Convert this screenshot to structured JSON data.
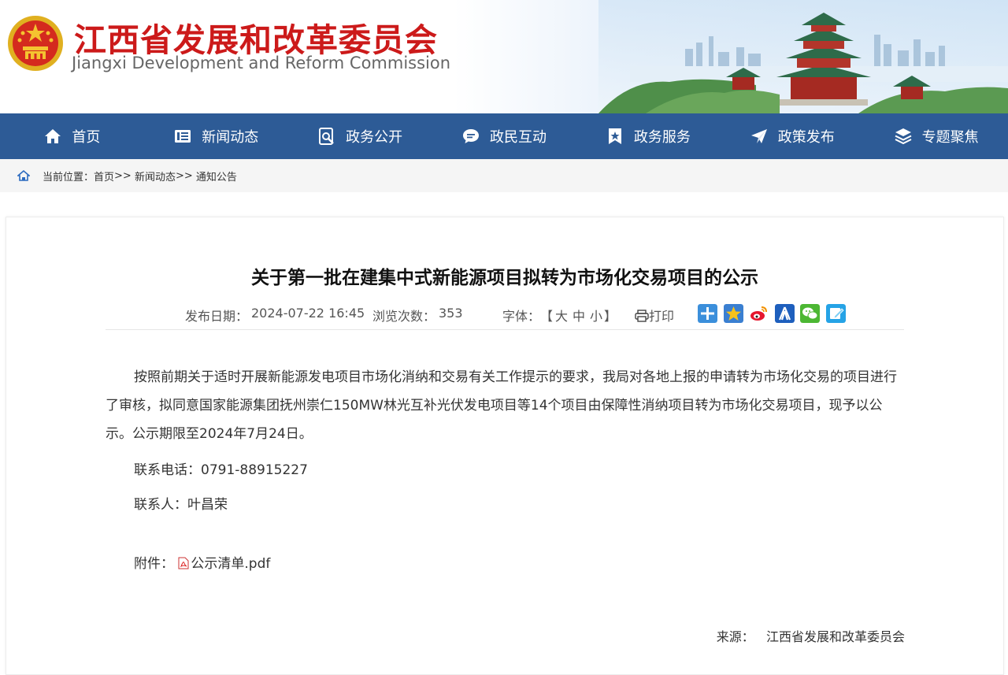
{
  "header": {
    "title": "江西省发展和改革委员会",
    "subtitle": "Jiangxi Development and Reform Commission"
  },
  "nav": {
    "items": [
      {
        "label": "首页",
        "icon": "home-icon"
      },
      {
        "label": "新闻动态",
        "icon": "news-icon"
      },
      {
        "label": "政务公开",
        "icon": "gov-open-icon"
      },
      {
        "label": "政民互动",
        "icon": "chat-icon"
      },
      {
        "label": "政务服务",
        "icon": "service-star-icon"
      },
      {
        "label": "政策发布",
        "icon": "send-icon"
      },
      {
        "label": "专题聚焦",
        "icon": "layers-icon"
      }
    ]
  },
  "breadcrumb": {
    "prefix": "当前位置：",
    "items": [
      "首页",
      ">>",
      "新闻动态",
      ">>",
      "通知公告"
    ]
  },
  "article": {
    "title": "关于第一批在建集中式新能源项目拟转为市场化交易项目的公示",
    "date_label": "发布日期：",
    "date": "2024-07-22 16:45",
    "views_label": "浏览次数：",
    "views": "353",
    "font_label": "字体：",
    "font_open": "【",
    "font_large": "大",
    "font_medium": "中",
    "font_small": "小",
    "font_close": "】",
    "print_label": "打印",
    "share_icons": [
      "plus-share-icon",
      "qzone-icon",
      "weibo-icon",
      "renren-icon",
      "wechat-icon",
      "note-icon"
    ],
    "paragraph": "按照前期关于适时开展新能源发电项目市场化消纳和交易有关工作提示的要求，我局对各地上报的申请转为市场化交易的项目进行了审核，拟同意国家能源集团抚州崇仁150MW林光互补光伏发电项目等14个项目由保障性消纳项目转为市场化交易项目，现予以公示。公示期限至2024年7月24日。",
    "phone": "联系电话：0791-88915227",
    "contact": "联系人：叶昌荣",
    "attachment_label": "附件：",
    "attachment_name": "公示清单.pdf",
    "source_label": "来源：",
    "source": "江西省发展和改革委员会"
  },
  "colors": {
    "nav_bg": "#2d5b96",
    "title_red": "#cc1a1a"
  }
}
